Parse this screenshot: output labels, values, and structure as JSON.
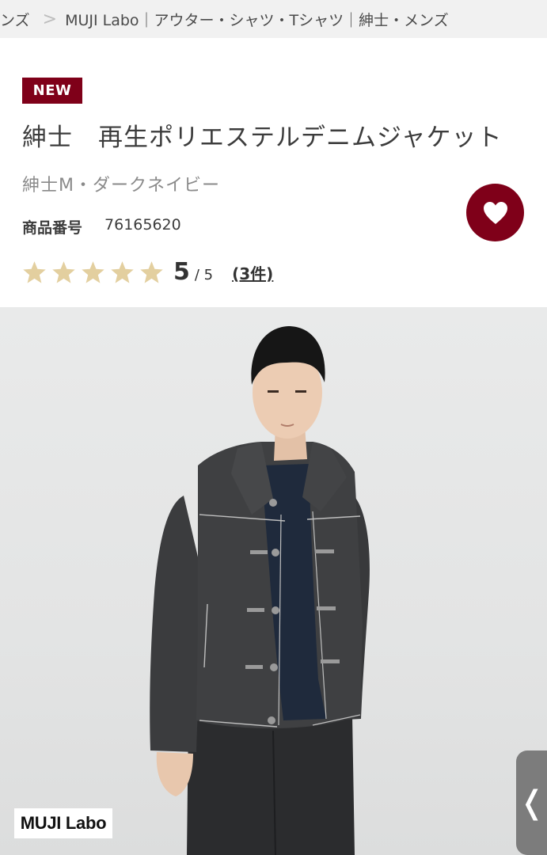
{
  "breadcrumb": {
    "items": [
      "ンズ",
      "MUJI Labo｜アウター・シャツ・Tシャツ｜紳士・メンズ"
    ],
    "separator": ">"
  },
  "product": {
    "badge": "NEW",
    "title": "紳士　再生ポリエステルデニムジャケット",
    "variant": "紳士M・ダークネイビー",
    "code_label": "商品番号",
    "code_value": "76165620",
    "rating": {
      "stars_filled": 5,
      "stars_total": 5,
      "score": "5",
      "score_max": "/ 5",
      "review_count": "(3件)"
    }
  },
  "favorite": {
    "icon": "heart-icon",
    "color": "#7f0019"
  },
  "image": {
    "logo_text": "MUJI Labo",
    "side_handle_icon": "chevron-left-icon",
    "side_handle_glyph": "❬"
  },
  "colors": {
    "accent": "#7f0019",
    "star": "#e3cf9f",
    "breadcrumb_bg": "#f1f1f1"
  }
}
